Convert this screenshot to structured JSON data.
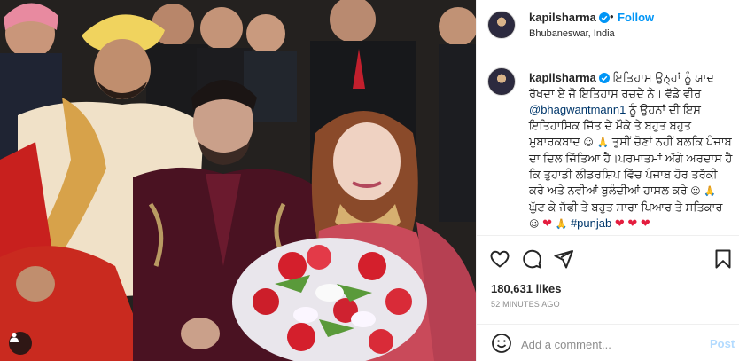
{
  "post": {
    "username": "kapilsharma",
    "verified": true,
    "follow_label": "Follow",
    "separator": "•",
    "location": "Bhubaneswar, India"
  },
  "caption": {
    "username": "kapilsharma",
    "text_1": "ਇਤਿਹਾਸ ਉਨ੍ਹਾਂ ਨੂੰ ਯਾਦ ਰੱਖਦਾ ਏ ਜੋ ਇਤਿਹਾਸ ਰਚਦੇ ਨੇ। ਵੱਡੇ ਵੀਰ",
    "mention": "@bhagwantmann1",
    "text_2": "ਨੂੰ ਉਹਨਾਂ ਦੀ ਇਸ ਇਤਿਹਾਸਿਕ ਜਿੱਤ ਦੇ ਮੌਕੇ ਤੇ ਬਹੁਤ ਬਹੁਤ ਮੁਬਾਰਕਬਾਦ",
    "text_3": "ਤੁਸੀਂ ਚੋਣਾਂ ਨਹੀਂ ਬਲਕਿ ਪੰਜਾਬ ਦਾ ਦਿਲ ਜਿੱਤਿਆ ਹੈ।ਪਰਮਾਤਮਾਂ ਅੱਗੇ ਅਰਦਾਸ ਹੈ ਕਿ ਤੁਹਾਡੀ ਲੀਡਰਸ਼ਿਪ ਵਿੱਚ ਪੰਜਾਬ ਹੋਰ ਤਰੱਕੀ ਕਰੇ ਅਤੇ ਨਵੀਆਂ ਬੁਲੰਦੀਆਂ ਹਾਸਲ ਕਰੇ",
    "text_4": "ਘੁੱਟ ਕੇ ਜੱਫੀ ਤੇ ਬਹੁਤ ਸਾਰਾ ਪਿਆਰ ਤੇ ਸਤਿਕਾਰ",
    "hashtag": "#punjab",
    "emoji": {
      "grin": "☺",
      "pray": "🙏",
      "heart": "❤"
    }
  },
  "engagement": {
    "likes": "180,631 likes",
    "time": "52 MINUTES AGO"
  },
  "comment": {
    "placeholder": "Add a comment...",
    "post_label": "Post"
  },
  "icons": {
    "like": "heart-outline",
    "comment": "speech-bubble",
    "share": "paper-plane",
    "save": "bookmark",
    "emoji": "smiley-face",
    "tagged": "user-silhouette"
  },
  "colors": {
    "link_blue": "#0095f6",
    "hashtag": "#00376b",
    "muted": "#8e8e8e",
    "post_disabled": "#b3dbff"
  }
}
